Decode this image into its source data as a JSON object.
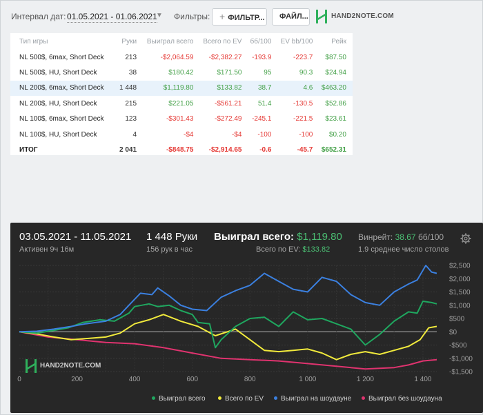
{
  "filters": {
    "date_label": "Интервал дат:",
    "date_range": "01.05.2021 - 01.06.2021",
    "filters_label": "Фильтры:",
    "filter_button": "ФИЛЬТР...",
    "file_button": "ФАЙЛ...",
    "logo_text": "HAND2NOTE.COM"
  },
  "table": {
    "headers": [
      "Тип игры",
      "Руки",
      "Выиграл всего",
      "Всего по EV",
      "бб/100",
      "EV bb/100",
      "Рейк"
    ],
    "rows": [
      [
        "NL 500$, 6max, Short Deck",
        "213",
        "-$2,064.59",
        "-$2,382.27",
        "-193.9",
        "-223.7",
        "$87.50"
      ],
      [
        "NL 500$, HU, Short Deck",
        "38",
        "$180.42",
        "$171.50",
        "95",
        "90.3",
        "$24.94"
      ],
      [
        "NL 200$, 6max, Short Deck",
        "1 448",
        "$1,119.80",
        "$133.82",
        "38.7",
        "4.6",
        "$463.20"
      ],
      [
        "NL 200$, HU, Short Deck",
        "215",
        "$221.05",
        "-$561.21",
        "51.4",
        "-130.5",
        "$52.86"
      ],
      [
        "NL 100$, 6max, Short Deck",
        "123",
        "-$301.43",
        "-$272.49",
        "-245.1",
        "-221.5",
        "$23.61"
      ],
      [
        "NL 100$, HU, Short Deck",
        "4",
        "-$4",
        "-$4",
        "-100",
        "-100",
        "$0.20"
      ]
    ],
    "total": [
      "ИТОГ",
      "2 041",
      "-$848.75",
      "-$2,914.65",
      "-0.6",
      "-45.7",
      "$652.31"
    ]
  },
  "session": {
    "date_range": "03.05.2021 - 11.05.2021",
    "active": "Активен 9ч 16м",
    "hands": "1 448 Руки",
    "hands_rate": "156 рук в час",
    "won_label": "Выиграл всего:",
    "won_value": "$1,119.80",
    "ev_label": "Всего по EV:",
    "ev_value": "$133.82",
    "winrate_label": "Винрейт:",
    "winrate_value": "38.67",
    "winrate_unit": "бб/100",
    "tables": "1.9 среднее число столов",
    "logo_text": "HAND2NOTE.COM"
  },
  "colors": {
    "total": "#1fa75f",
    "ev": "#f1ea3c",
    "showdown": "#3b80e0",
    "non_showdown": "#e0336f"
  },
  "chart_data": {
    "type": "line",
    "x_ticks": [
      "0",
      "200",
      "400",
      "600",
      "800",
      "1 000",
      "1 200",
      "1 400"
    ],
    "y_ticks": [
      "$2,500",
      "$2,000",
      "$1,500",
      "$1,000",
      "$500",
      "$0",
      "-$500",
      "-$1,000",
      "-$1,500"
    ],
    "xlim": [
      0,
      1448
    ],
    "ylim": [
      -1500,
      2500
    ],
    "series": [
      {
        "name": "Выиграл всего",
        "color_key": "total",
        "x": [
          0,
          60,
          120,
          170,
          220,
          280,
          330,
          380,
          400,
          450,
          480,
          520,
          560,
          600,
          620,
          660,
          680,
          700,
          750,
          800,
          850,
          900,
          950,
          1000,
          1050,
          1100,
          1150,
          1200,
          1250,
          1300,
          1350,
          1380,
          1400,
          1430,
          1448
        ],
        "values": [
          0,
          -50,
          50,
          150,
          350,
          450,
          400,
          700,
          950,
          1050,
          950,
          1000,
          800,
          650,
          350,
          300,
          -600,
          -300,
          200,
          500,
          550,
          200,
          750,
          450,
          500,
          300,
          100,
          -500,
          -100,
          400,
          750,
          700,
          1150,
          1100,
          1050
        ]
      },
      {
        "name": "Всего по EV",
        "color_key": "ev",
        "x": [
          0,
          60,
          120,
          180,
          240,
          300,
          350,
          400,
          450,
          500,
          560,
          620,
          680,
          750,
          800,
          850,
          900,
          950,
          1000,
          1050,
          1100,
          1150,
          1200,
          1250,
          1300,
          1350,
          1390,
          1420,
          1448
        ],
        "values": [
          0,
          -80,
          -200,
          -300,
          -250,
          -200,
          -50,
          300,
          450,
          650,
          400,
          200,
          -150,
          100,
          -300,
          -700,
          -750,
          -700,
          -650,
          -800,
          -1050,
          -850,
          -750,
          -850,
          -700,
          -550,
          -300,
          150,
          200
        ]
      },
      {
        "name": "Выиграл на шоудауне",
        "color_key": "showdown",
        "x": [
          0,
          60,
          120,
          180,
          230,
          300,
          350,
          380,
          420,
          460,
          480,
          520,
          560,
          600,
          650,
          700,
          750,
          800,
          850,
          900,
          950,
          1000,
          1050,
          1100,
          1150,
          1200,
          1250,
          1300,
          1350,
          1380,
          1410,
          1430,
          1448
        ],
        "values": [
          0,
          20,
          100,
          200,
          300,
          400,
          650,
          1000,
          1450,
          1400,
          1650,
          1350,
          1000,
          850,
          800,
          1300,
          1550,
          1750,
          2200,
          1900,
          1600,
          1500,
          2050,
          1900,
          1400,
          1100,
          1000,
          1500,
          1800,
          1950,
          2500,
          2250,
          2200
        ]
      },
      {
        "name": "Выиграл без шоудауна",
        "color_key": "non_showdown",
        "x": [
          0,
          100,
          200,
          300,
          400,
          500,
          600,
          700,
          800,
          900,
          1000,
          1100,
          1200,
          1300,
          1350,
          1400,
          1448
        ],
        "values": [
          0,
          -200,
          -300,
          -400,
          -450,
          -600,
          -800,
          -1000,
          -1050,
          -1100,
          -1200,
          -1300,
          -1400,
          -1350,
          -1250,
          -1100,
          -1050
        ]
      }
    ]
  }
}
